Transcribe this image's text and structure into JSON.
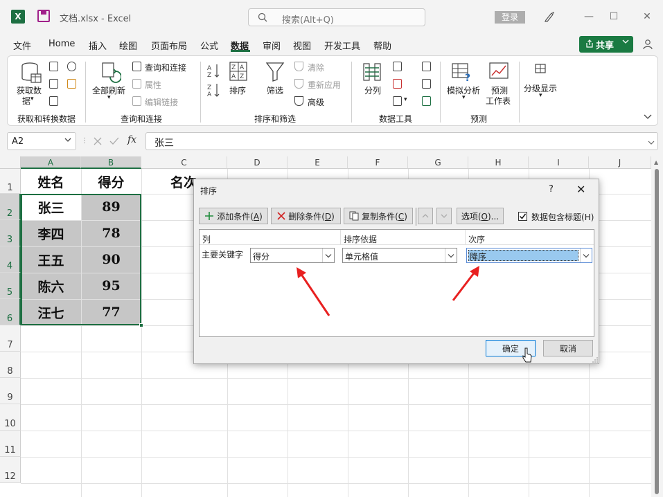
{
  "window": {
    "app_letter": "X",
    "doc_title": "文档.xlsx  -  Excel",
    "search_placeholder": "搜索(Alt+Q)",
    "login_label": "登录",
    "min_glyph": "—",
    "max_glyph": "☐",
    "close_glyph": "✕"
  },
  "menu": {
    "items": [
      "文件",
      "Home",
      "插入",
      "绘图",
      "页面布局",
      "公式",
      "数据",
      "审阅",
      "视图",
      "开发工具",
      "帮助"
    ],
    "active": "数据",
    "share_label": "共享"
  },
  "ribbon": {
    "get_data": "获取数",
    "get_data2": "据",
    "refresh_all": "全部刷新",
    "queries_connections": "查询和连接",
    "properties": "属性",
    "edit_links": "编辑链接",
    "sort": "排序",
    "filter": "筛选",
    "clear": "清除",
    "reapply": "重新应用",
    "advanced": "高级",
    "text_to_columns": "分列",
    "what_if": "模拟分析",
    "forecast_sheet": "预测",
    "forecast_sheet2": "工作表",
    "outline": "分级显示",
    "groups": [
      "获取和转换数据",
      "查询和连接",
      "排序和筛选",
      "数据工具",
      "预测"
    ]
  },
  "formula_bar": {
    "name_box": "A2",
    "fx": "fx",
    "value": "张三"
  },
  "sheet": {
    "columns": [
      "A",
      "B",
      "C",
      "D",
      "E",
      "F",
      "G",
      "H",
      "I",
      "J"
    ],
    "rows": [
      "1",
      "2",
      "3",
      "4",
      "5",
      "6",
      "7",
      "8",
      "9",
      "10",
      "11",
      "12"
    ],
    "headers": [
      "姓名",
      "得分",
      "名次"
    ],
    "data": [
      [
        "张三",
        "89"
      ],
      [
        "李四",
        "78"
      ],
      [
        "王五",
        "90"
      ],
      [
        "陈六",
        "95"
      ],
      [
        "汪七",
        "77"
      ]
    ]
  },
  "dialog": {
    "title": "排序",
    "help": "?",
    "close": "✕",
    "add_condition": "添加条件(",
    "add_key": "A",
    "delete_condition": "删除条件(",
    "delete_key": "D",
    "copy_condition": "复制条件(",
    "copy_key": "C",
    "options": "选项(",
    "options_key": "O",
    "options_suffix": ")...",
    "paren_close": ")",
    "has_headers": "数据包含标题(",
    "has_headers_key": "H",
    "has_headers_checked": true,
    "col_header": "列",
    "sort_on_header": "排序依据",
    "order_header": "次序",
    "primary_key_label": "主要关键字",
    "column_value": "得分",
    "sort_on_value": "单元格值",
    "order_value": "降序",
    "ok": "确定",
    "cancel": "取消"
  },
  "colors": {
    "excel_green": "#1d6f42",
    "share_green": "#1a7a42",
    "annotation_arrow": "#e82020",
    "selection_fill": "#c6c6c6",
    "highlight_blue": "#99c9ef"
  }
}
